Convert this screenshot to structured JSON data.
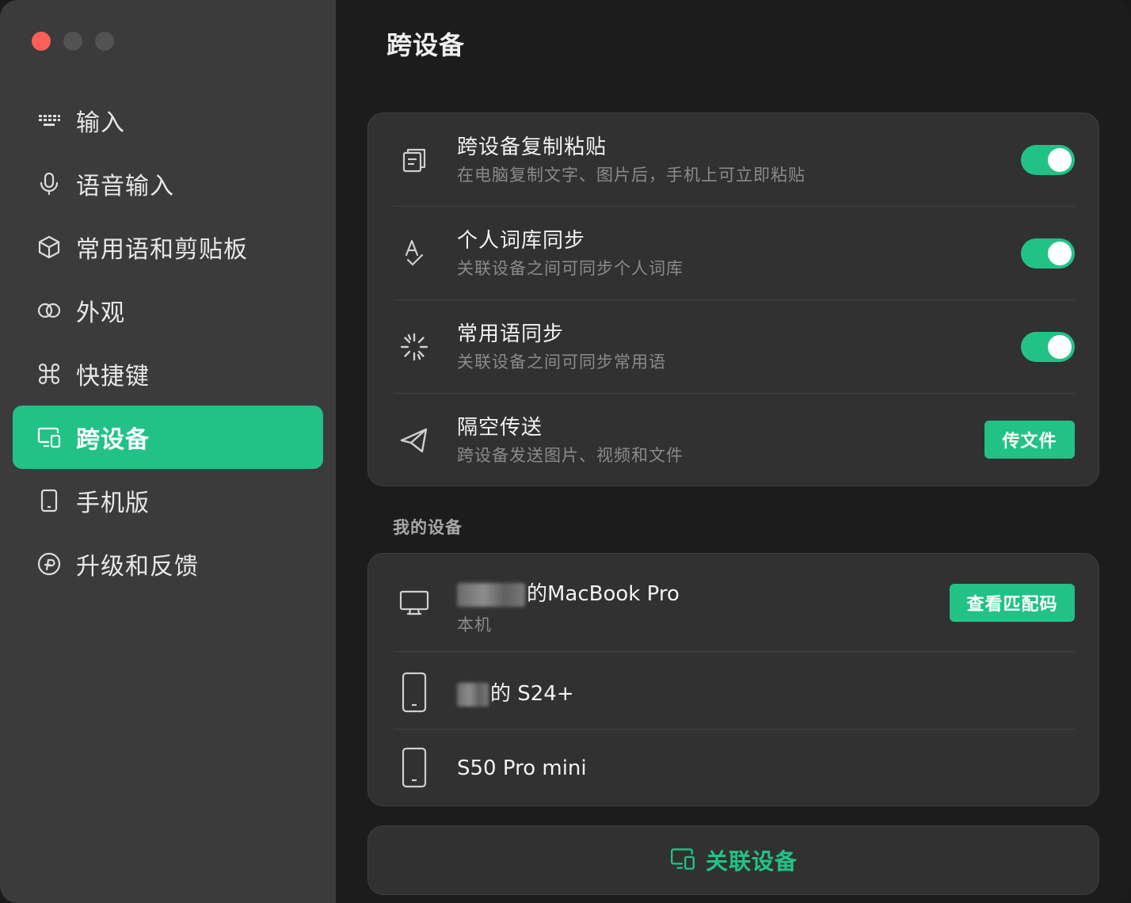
{
  "window": {
    "traffic_lights": [
      "close",
      "minimize",
      "zoom"
    ],
    "colors": {
      "close": "#ff5f57",
      "inactive": "#525252",
      "accent": "#22c287",
      "sidebar_bg": "#3b3b3b",
      "main_bg": "#1c1c1c",
      "card_bg": "#313131"
    }
  },
  "sidebar": {
    "items": [
      {
        "label": "输入",
        "icon": "keyboard-icon",
        "active": false
      },
      {
        "label": "语音输入",
        "icon": "microphone-icon",
        "active": false
      },
      {
        "label": "常用语和剪贴板",
        "icon": "cube-icon",
        "active": false
      },
      {
        "label": "外观",
        "icon": "rings-icon",
        "active": false
      },
      {
        "label": "快捷键",
        "icon": "command-icon",
        "active": false
      },
      {
        "label": "跨设备",
        "icon": "devices-icon",
        "active": true
      },
      {
        "label": "手机版",
        "icon": "phone-icon",
        "active": false
      },
      {
        "label": "升级和反馈",
        "icon": "upgrade-icon",
        "active": false
      }
    ]
  },
  "main": {
    "title": "跨设备",
    "features": [
      {
        "title": "跨设备复制粘贴",
        "subtitle": "在电脑复制文字、图片后，手机上可立即粘贴",
        "icon": "clipboard-copy-icon",
        "toggle": true
      },
      {
        "title": "个人词库同步",
        "subtitle": "关联设备之间可同步个人词库",
        "icon": "spellcheck-icon",
        "toggle": true
      },
      {
        "title": "常用语同步",
        "subtitle": "关联设备之间可同步常用语",
        "icon": "sparkle-icon",
        "toggle": true
      },
      {
        "title": "隔空传送",
        "subtitle": "跨设备发送图片、视频和文件",
        "icon": "send-icon",
        "button": "传文件"
      }
    ],
    "devices_section_label": "我的设备",
    "devices": [
      {
        "name": "的MacBook Pro",
        "subtitle": "本机",
        "icon": "monitor-icon",
        "button": "查看匹配码"
      },
      {
        "name": "的 S24+",
        "icon": "phone-icon"
      },
      {
        "name": "S50 Pro mini",
        "icon": "phone-icon"
      }
    ],
    "link_button": {
      "label": "关联设备",
      "icon": "devices-icon"
    }
  }
}
